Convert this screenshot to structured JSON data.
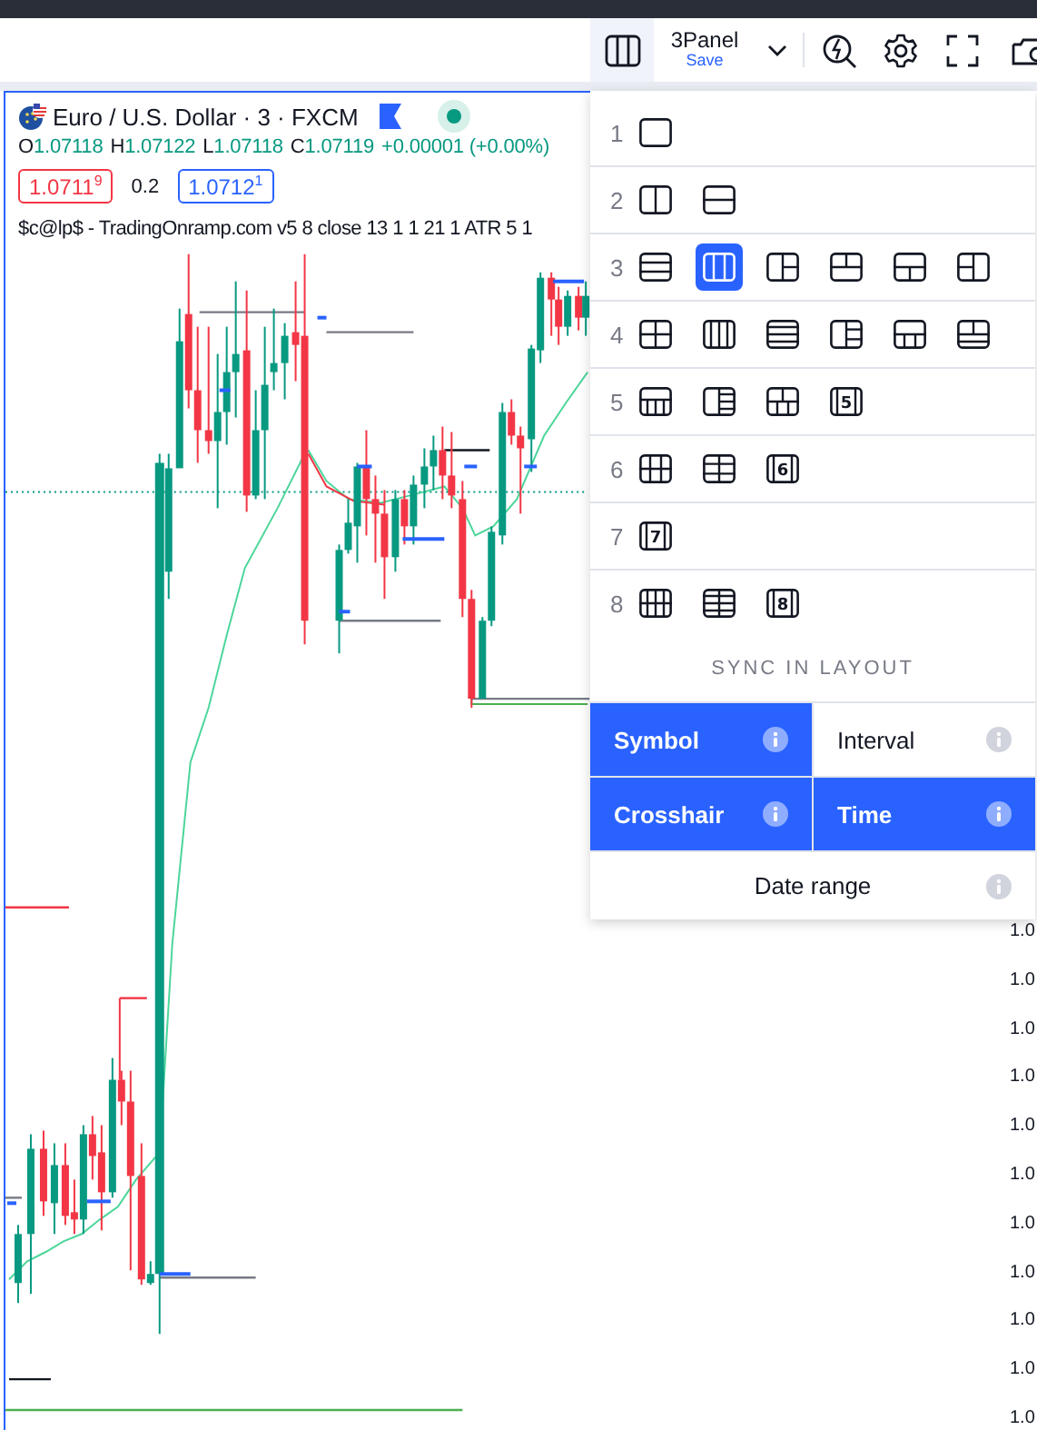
{
  "toolbar": {
    "layout_name": "3Panel",
    "save_label": "Save"
  },
  "legend": {
    "symbol": "Euro / U.S. Dollar · 3 · FXCM",
    "ohlc": [
      {
        "label": "O",
        "value": "1.07118"
      },
      {
        "label": "H",
        "value": "1.07122"
      },
      {
        "label": "L",
        "value": "1.07118"
      },
      {
        "label": "C",
        "value": "1.07119"
      }
    ],
    "change": "+0.00001 (+0.00%)",
    "bid": "1.0711$^{9}$",
    "spread": "0.2",
    "ask": "1.0712$^{1}$",
    "indicator": "$c@lp$ - TradingOnramp.com v5 8 close 13 1 1 21 1 ATR 5 1"
  },
  "layout_menu": {
    "groups": [
      {
        "count": "1",
        "options": [
          {
            "selected": false
          }
        ]
      },
      {
        "count": "2",
        "options": [
          {
            "selected": false
          },
          {
            "selected": false
          }
        ]
      },
      {
        "count": "3",
        "options": [
          {
            "selected": false
          },
          {
            "selected": true
          },
          {
            "selected": false
          },
          {
            "selected": false
          },
          {
            "selected": false
          },
          {
            "selected": false
          }
        ]
      },
      {
        "count": "4",
        "options": [
          {
            "selected": false
          },
          {
            "selected": false
          },
          {
            "selected": false
          },
          {
            "selected": false
          },
          {
            "selected": false
          },
          {
            "selected": false
          }
        ]
      },
      {
        "count": "5",
        "options": [
          {
            "selected": false
          },
          {
            "selected": false
          },
          {
            "selected": false
          },
          {
            "selected": false,
            "badge": "5"
          }
        ]
      },
      {
        "count": "6",
        "options": [
          {
            "selected": false
          },
          {
            "selected": false
          },
          {
            "selected": false,
            "badge": "6"
          }
        ]
      },
      {
        "count": "7",
        "options": [
          {
            "selected": false,
            "badge": "7"
          }
        ]
      },
      {
        "count": "8",
        "options": [
          {
            "selected": false
          },
          {
            "selected": false
          },
          {
            "selected": false,
            "badge": "8"
          }
        ]
      }
    ],
    "sync_title": "SYNC IN LAYOUT",
    "sync_options": [
      {
        "label": "Symbol",
        "selected": true
      },
      {
        "label": "Interval",
        "selected": false
      },
      {
        "label": "Crosshair",
        "selected": true
      },
      {
        "label": "Time",
        "selected": true
      },
      {
        "label": "Date range",
        "selected": false
      }
    ]
  },
  "price_scale": {
    "labels": [
      "1.0",
      "1.0",
      "1.0",
      "1.0",
      "1.0",
      "1.0",
      "1.0",
      "1.0",
      "1.0",
      "1.0",
      "1.0"
    ]
  }
}
